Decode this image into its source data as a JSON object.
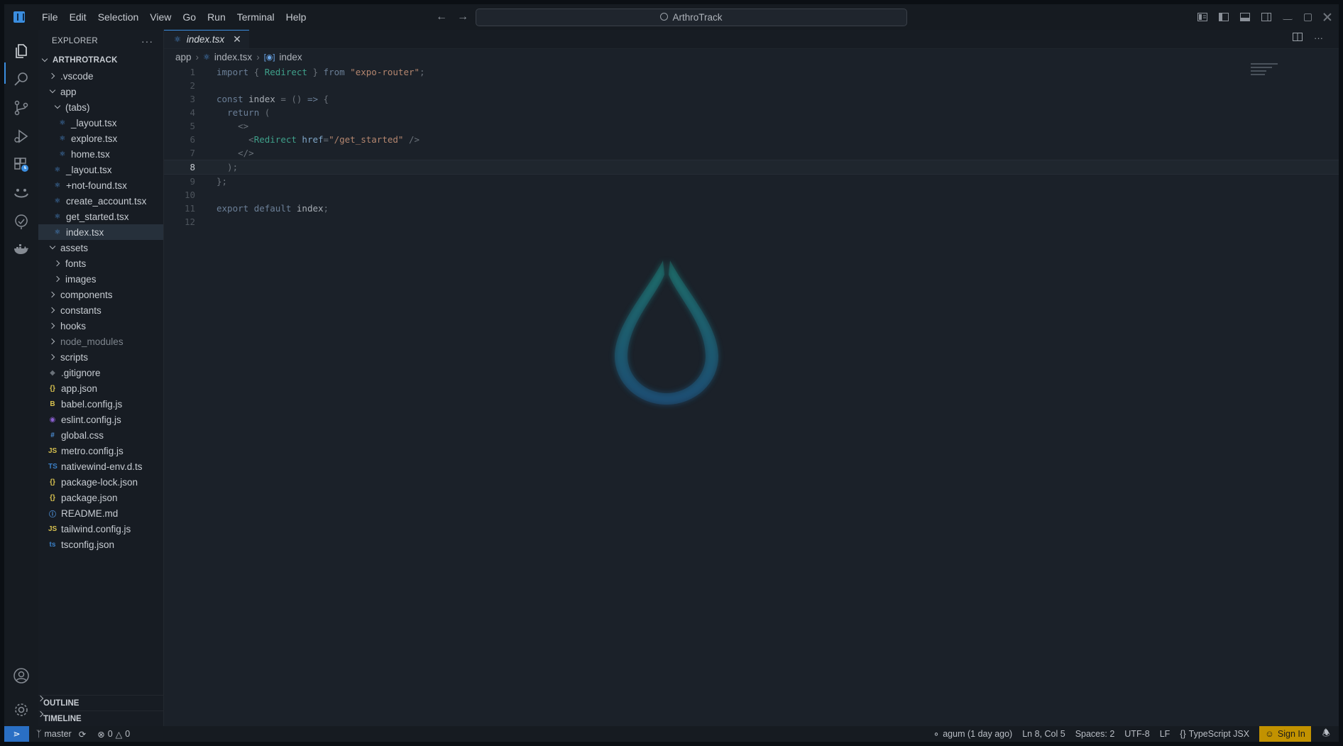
{
  "window": {
    "menu": [
      "File",
      "Edit",
      "Selection",
      "View",
      "Go",
      "Run",
      "Terminal",
      "Help"
    ],
    "search_text": "ArthroTrack"
  },
  "sidebar": {
    "title": "EXPLORER",
    "more": "···",
    "project": "ARTHROTRACK",
    "tree": [
      {
        "label": ".vscode",
        "type": "folder",
        "open": false,
        "depth": 1
      },
      {
        "label": "app",
        "type": "folder",
        "open": true,
        "depth": 1
      },
      {
        "label": "(tabs)",
        "type": "folder",
        "open": true,
        "depth": 2
      },
      {
        "label": "_layout.tsx",
        "type": "tsx",
        "depth": 3
      },
      {
        "label": "explore.tsx",
        "type": "tsx",
        "depth": 3
      },
      {
        "label": "home.tsx",
        "type": "tsx",
        "depth": 3
      },
      {
        "label": "_layout.tsx",
        "type": "tsx",
        "depth": 2
      },
      {
        "label": "+not-found.tsx",
        "type": "tsx",
        "depth": 2
      },
      {
        "label": "create_account.tsx",
        "type": "tsx",
        "depth": 2
      },
      {
        "label": "get_started.tsx",
        "type": "tsx",
        "depth": 2
      },
      {
        "label": "index.tsx",
        "type": "tsx",
        "depth": 2,
        "selected": true
      },
      {
        "label": "assets",
        "type": "folder",
        "open": true,
        "depth": 1
      },
      {
        "label": "fonts",
        "type": "folder",
        "open": false,
        "depth": 2
      },
      {
        "label": "images",
        "type": "folder",
        "open": false,
        "depth": 2
      },
      {
        "label": "components",
        "type": "folder",
        "open": false,
        "depth": 1
      },
      {
        "label": "constants",
        "type": "folder",
        "open": false,
        "depth": 1
      },
      {
        "label": "hooks",
        "type": "folder",
        "open": false,
        "depth": 1
      },
      {
        "label": "node_modules",
        "type": "folder",
        "open": false,
        "depth": 1,
        "dim": true
      },
      {
        "label": "scripts",
        "type": "folder",
        "open": false,
        "depth": 1
      },
      {
        "label": ".gitignore",
        "type": "git",
        "depth": 1
      },
      {
        "label": "app.json",
        "type": "json",
        "depth": 1
      },
      {
        "label": "babel.config.js",
        "type": "babel",
        "depth": 1
      },
      {
        "label": "eslint.config.js",
        "type": "eslint",
        "depth": 1
      },
      {
        "label": "global.css",
        "type": "css",
        "depth": 1
      },
      {
        "label": "metro.config.js",
        "type": "js",
        "depth": 1
      },
      {
        "label": "nativewind-env.d.ts",
        "type": "ts",
        "depth": 1
      },
      {
        "label": "package-lock.json",
        "type": "json",
        "depth": 1
      },
      {
        "label": "package.json",
        "type": "json",
        "depth": 1
      },
      {
        "label": "README.md",
        "type": "info",
        "depth": 1
      },
      {
        "label": "tailwind.config.js",
        "type": "js",
        "depth": 1
      },
      {
        "label": "tsconfig.json",
        "type": "tsconfig",
        "depth": 1
      }
    ],
    "outline": "OUTLINE",
    "timeline": "TIMELINE"
  },
  "editor": {
    "tab_label": "index.tsx",
    "breadcrumb": [
      "app",
      "index.tsx",
      "index"
    ],
    "current_line": 8,
    "lines": [
      [
        [
          "kw",
          "import "
        ],
        [
          "pun",
          "{ "
        ],
        [
          "tag",
          "Redirect"
        ],
        [
          "pun",
          " } "
        ],
        [
          "kw",
          "from "
        ],
        [
          "str",
          "\"expo-router\""
        ],
        [
          "pun",
          ";"
        ]
      ],
      [],
      [
        [
          "kw",
          "const "
        ],
        [
          "id",
          "index "
        ],
        [
          "pun",
          "= () "
        ],
        [
          "kw",
          "=> "
        ],
        [
          "pun",
          "{"
        ]
      ],
      [
        [
          "pun",
          "  "
        ],
        [
          "kw",
          "return "
        ],
        [
          "pun",
          "("
        ]
      ],
      [
        [
          "pun",
          "    <>"
        ]
      ],
      [
        [
          "pun",
          "      <"
        ],
        [
          "tag",
          "Redirect "
        ],
        [
          "attr",
          "href"
        ],
        [
          "pun",
          "="
        ],
        [
          "str",
          "\"/get_started\""
        ],
        [
          "pun",
          " />"
        ]
      ],
      [
        [
          "pun",
          "    </>"
        ]
      ],
      [
        [
          "pun",
          "  );"
        ]
      ],
      [
        [
          "pun",
          "};"
        ]
      ],
      [],
      [
        [
          "kw",
          "export "
        ],
        [
          "kw",
          "default "
        ],
        [
          "id",
          "index"
        ],
        [
          "pun",
          ";"
        ]
      ],
      []
    ]
  },
  "status": {
    "branch": "master",
    "errors": "0",
    "warnings": "0",
    "blame": "agum (1 day ago)",
    "position": "Ln 8, Col 5",
    "spaces": "Spaces: 2",
    "encoding": "UTF-8",
    "eol": "LF",
    "language": "TypeScript JSX",
    "sign_in": "Sign In"
  },
  "colors": {
    "accent": "#3b8ee0",
    "tsx_icon": "#4d8fd6",
    "json_icon": "#d6c04f",
    "js_icon": "#d6c04f",
    "ts_icon": "#3a7fc6",
    "sign_in_bg": "#c29200"
  }
}
